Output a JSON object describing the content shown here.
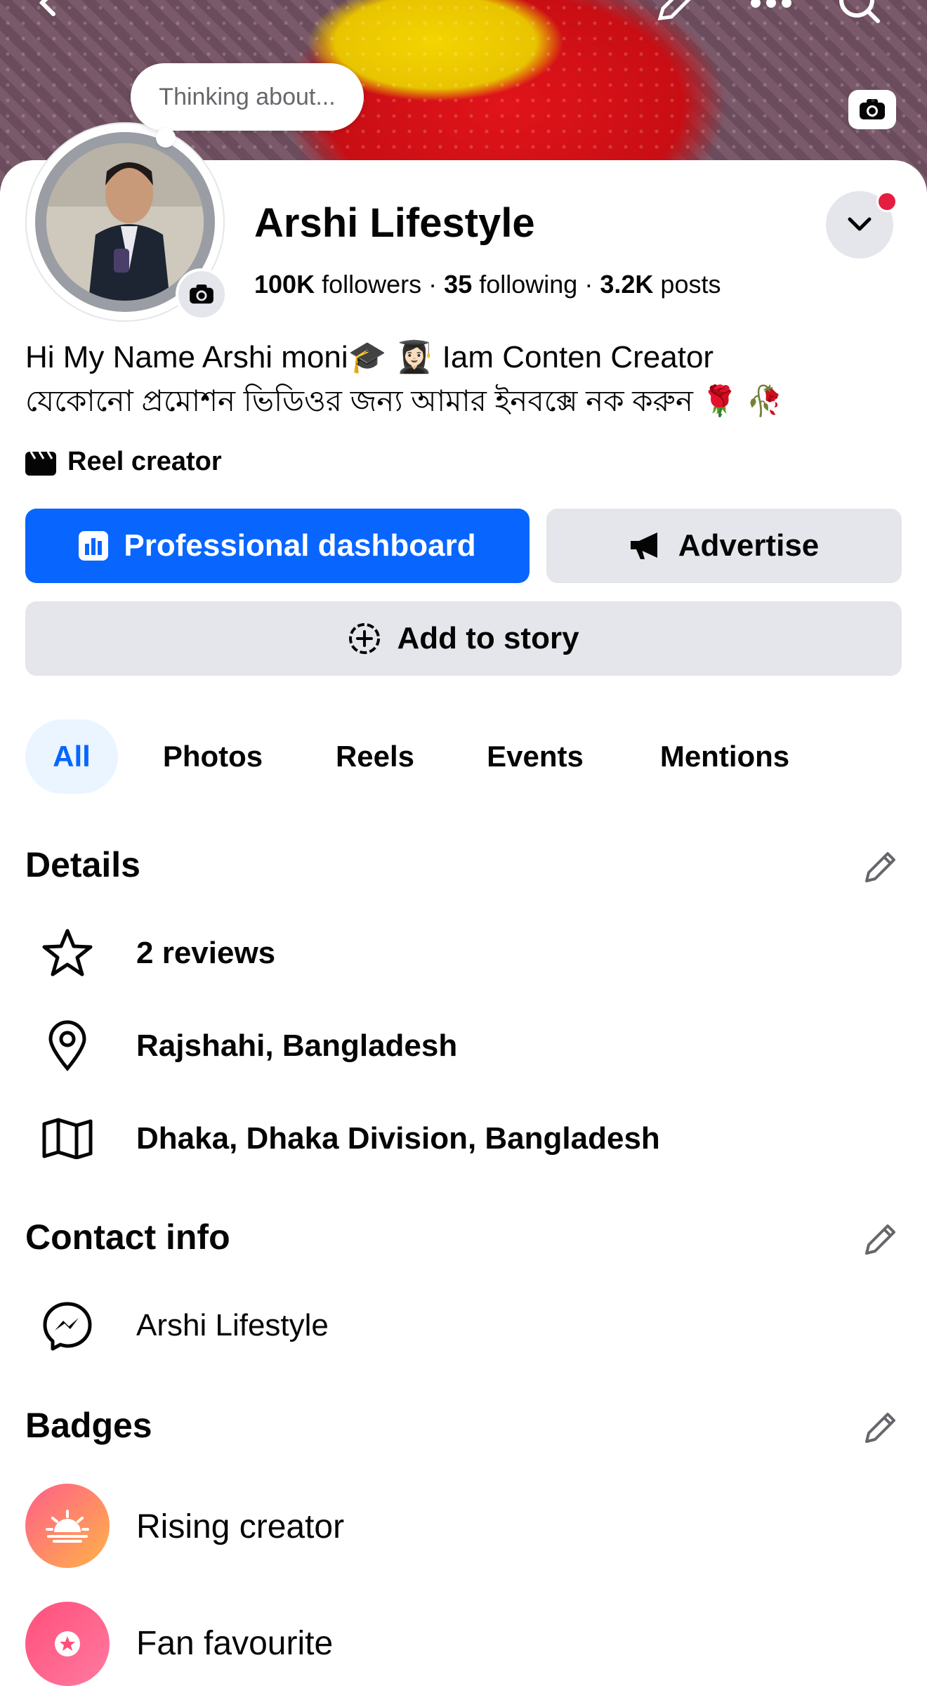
{
  "thought_bubble": "Thinking about...",
  "profile": {
    "name": "Arshi Lifestyle",
    "followers_count": "100K",
    "followers_label": "followers",
    "following_count": "35",
    "following_label": "following",
    "posts_count": "3.2K",
    "posts_label": "posts",
    "separator": "·"
  },
  "bio": {
    "line1": "Hi My Name Arshi moni🎓 👩🏻‍🎓 Iam Conten Creator",
    "line2": "যেকোনো প্রমোশন ভিডিওর জন্য আমার ইনবক্সে নক করুন 🌹 🥀"
  },
  "category": "Reel creator",
  "buttons": {
    "dashboard": "Professional dashboard",
    "advertise": "Advertise",
    "add_story": "Add to story"
  },
  "tabs": [
    "All",
    "Photos",
    "Reels",
    "Events",
    "Mentions"
  ],
  "details": {
    "title": "Details",
    "items": [
      "2 reviews",
      "Rajshahi, Bangladesh",
      "Dhaka, Dhaka Division, Bangladesh"
    ]
  },
  "contact": {
    "title": "Contact info",
    "messenger": "Arshi Lifestyle"
  },
  "badges": {
    "title": "Badges",
    "items": [
      "Rising creator",
      "Fan favourite"
    ]
  },
  "colors": {
    "accent": "#0866ff",
    "notification": "#e41e3f"
  },
  "icons": {
    "top_bar": [
      "back-arrow-icon",
      "pencil-icon",
      "more-icon",
      "search-icon"
    ],
    "details": [
      "star-icon",
      "location-pin-icon",
      "map-icon"
    ],
    "contact": [
      "messenger-icon"
    ]
  }
}
